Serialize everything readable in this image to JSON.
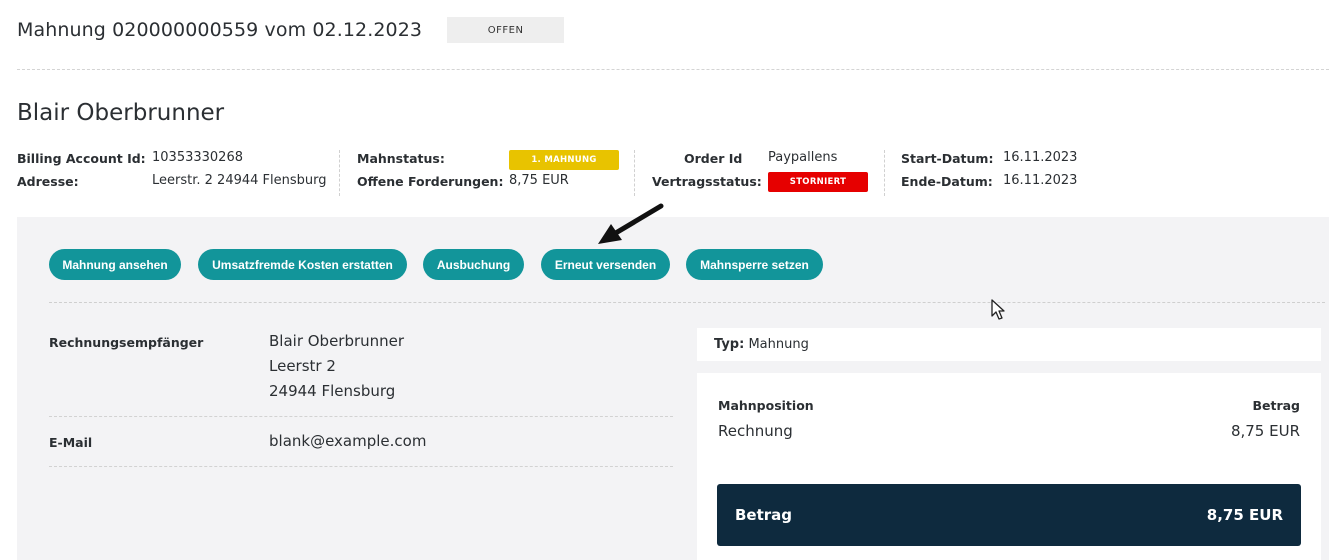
{
  "header": {
    "title": "Mahnung 020000000559 vom 02.12.2023",
    "status": "OFFEN"
  },
  "customer": {
    "name": "Blair Oberbrunner"
  },
  "info": {
    "billing_account_label": "Billing Account Id:",
    "billing_account_value": "10353330268",
    "address_label": "Adresse:",
    "address_value": "Leerstr. 2 24944 Flensburg",
    "mahnstatus_label": "Mahnstatus:",
    "mahnstatus_badge": "1. MAHNUNG",
    "offene_label": "Offene Forderungen:",
    "offene_value": "8,75 EUR",
    "order_label": "Order Id",
    "order_value": "Paypallens",
    "vertragsstatus_label": "Vertragsstatus:",
    "vertragsstatus_badge": "STORNIERT",
    "start_label": "Start-Datum:",
    "start_value": "16.11.2023",
    "end_label": "Ende-Datum:",
    "end_value": "16.11.2023"
  },
  "actions": [
    "Mahnung ansehen",
    "Umsatzfremde Kosten erstatten",
    "Ausbuchung",
    "Erneut versenden",
    "Mahnsperre setzen"
  ],
  "details": {
    "recipient_label": "Rechnungsempfänger",
    "recipient_name": "Blair Oberbrunner",
    "recipient_street": "Leerstr 2",
    "recipient_city": "24944 Flensburg",
    "email_label": "E-Mail",
    "email_value": "blank@example.com"
  },
  "typ": {
    "label": "Typ:",
    "value": "Mahnung"
  },
  "positions": {
    "col_position": "Mahnposition",
    "col_amount": "Betrag",
    "row_position": "Rechnung",
    "row_amount": "8,75 EUR",
    "total_label": "Betrag",
    "total_value": "8,75 EUR"
  },
  "colors": {
    "accent_teal": "#12959a",
    "badge_yellow": "#e8c300",
    "badge_red": "#e60000",
    "total_bg": "#0e2a3e"
  }
}
